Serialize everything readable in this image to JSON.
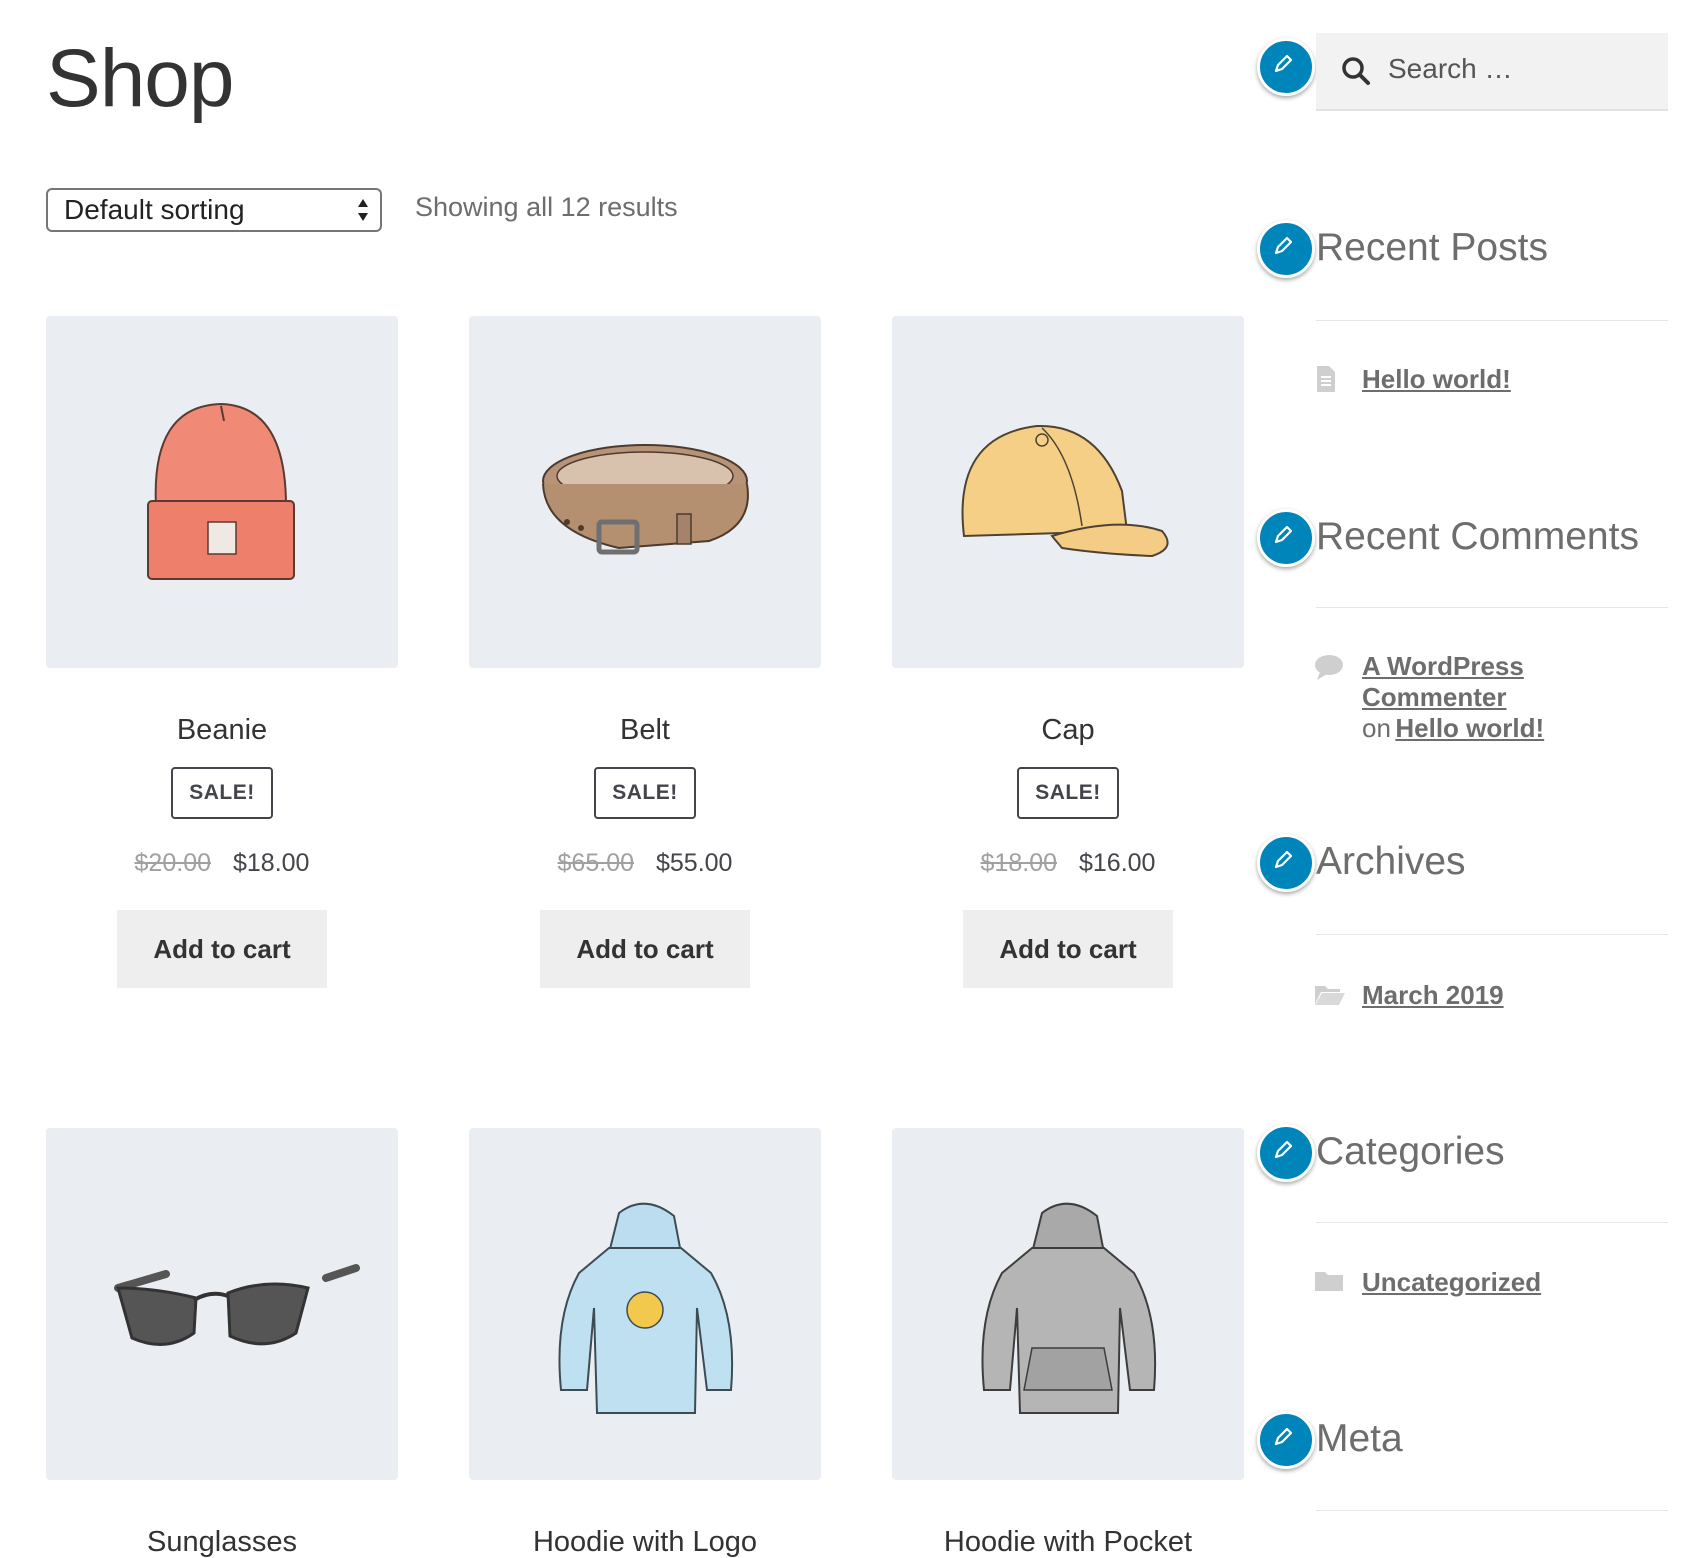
{
  "page": {
    "title": "Shop"
  },
  "ordering": {
    "selected": "Default sorting"
  },
  "results": {
    "text": "Showing all 12 results"
  },
  "products": [
    {
      "name": "Beanie",
      "badge": "SALE!",
      "old_price": "$20.00",
      "price": "$18.00",
      "button": "Add to cart"
    },
    {
      "name": "Belt",
      "badge": "SALE!",
      "old_price": "$65.00",
      "price": "$55.00",
      "button": "Add to cart"
    },
    {
      "name": "Cap",
      "badge": "SALE!",
      "old_price": "$18.00",
      "price": "$16.00",
      "button": "Add to cart"
    },
    {
      "name": "Sunglasses"
    },
    {
      "name": "Hoodie with Logo"
    },
    {
      "name": "Hoodie with Pocket"
    }
  ],
  "sidebar": {
    "search": {
      "placeholder": "Search …"
    },
    "recent_posts": {
      "title": "Recent Posts",
      "items": [
        "Hello world!"
      ]
    },
    "recent_comments": {
      "title": "Recent Comments",
      "author": "A WordPress Commenter",
      "on": "on",
      "post": "Hello world!"
    },
    "archives": {
      "title": "Archives",
      "items": [
        "March 2019"
      ]
    },
    "categories": {
      "title": "Categories",
      "items": [
        "Uncategorized"
      ]
    },
    "meta": {
      "title": "Meta"
    }
  },
  "colors": {
    "accent_edit": "#0085ba",
    "image_bg": "#eaeef2",
    "button_bg": "#eeeeee",
    "text": "#43454b"
  },
  "icons": [
    "pencil-icon",
    "search-icon",
    "document-icon",
    "comment-icon",
    "folder-open-icon",
    "folder-icon",
    "select-arrows-icon"
  ]
}
